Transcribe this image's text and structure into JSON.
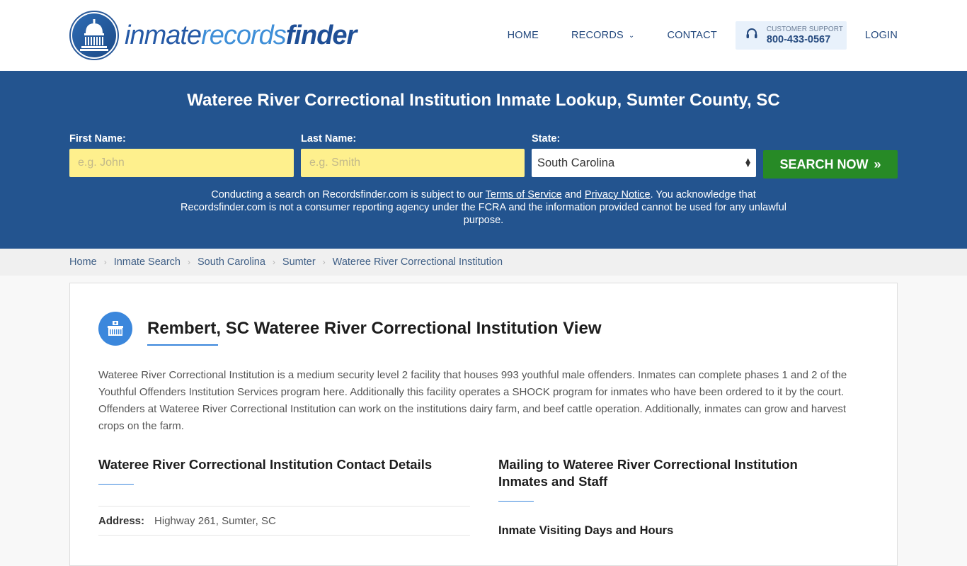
{
  "header": {
    "logo": {
      "part1": "inmate",
      "part2": "records",
      "part3": "finder"
    },
    "nav": [
      {
        "label": "HOME"
      },
      {
        "label": "RECORDS",
        "has_dropdown": true
      },
      {
        "label": "CONTACT"
      }
    ],
    "support": {
      "label": "CUSTOMER SUPPORT",
      "phone": "800-433-0567",
      "icon": "headset-icon"
    },
    "login_label": "LOGIN"
  },
  "hero": {
    "title": "Wateree River Correctional Institution Inmate Lookup, Sumter County, SC",
    "first_name": {
      "label": "First Name:",
      "placeholder": "e.g. John",
      "value": ""
    },
    "last_name": {
      "label": "Last Name:",
      "placeholder": "e.g. Smith",
      "value": ""
    },
    "state": {
      "label": "State:",
      "selected": "South Carolina"
    },
    "search_button": "SEARCH NOW",
    "disclaimer": {
      "part1": "Conducting a search on Recordsfinder.com is subject to our ",
      "terms_link": "Terms of Service",
      "part2": " and ",
      "privacy_link": "Privacy Notice",
      "part3": ". You acknowledge that Recordsfinder.com is not a consumer reporting agency under the FCRA and the information provided cannot be used for any unlawful purpose."
    }
  },
  "breadcrumb": [
    "Home",
    "Inmate Search",
    "South Carolina",
    "Sumter",
    "Wateree River Correctional Institution"
  ],
  "card": {
    "title": "Rembert, SC Wateree River Correctional Institution View",
    "description": "Wateree River Correctional Institution is a medium security level 2 facility that houses 993 youthful male offenders. Inmates can complete phases 1 and 2 of the Youthful Offenders Institution Services program here. Additionally this facility operates a SHOCK program for inmates who have been ordered to it by the court. Offenders at Wateree River Correctional Institution can work on the institutions dairy farm, and beef cattle operation. Additionally, inmates can grow and harvest crops on the farm.",
    "contact": {
      "title": "Wateree River Correctional Institution Contact Details",
      "address_label": "Address:",
      "address_value": "Highway 261, Sumter, SC"
    },
    "mailing": {
      "title": "Mailing to Wateree River Correctional Institution Inmates and Staff",
      "visiting_title": "Inmate Visiting Days and Hours"
    }
  },
  "colors": {
    "brand_blue": "#23548f",
    "accent_blue": "#3b87dc",
    "search_green": "#278a26",
    "input_yellow": "#fef08d"
  }
}
